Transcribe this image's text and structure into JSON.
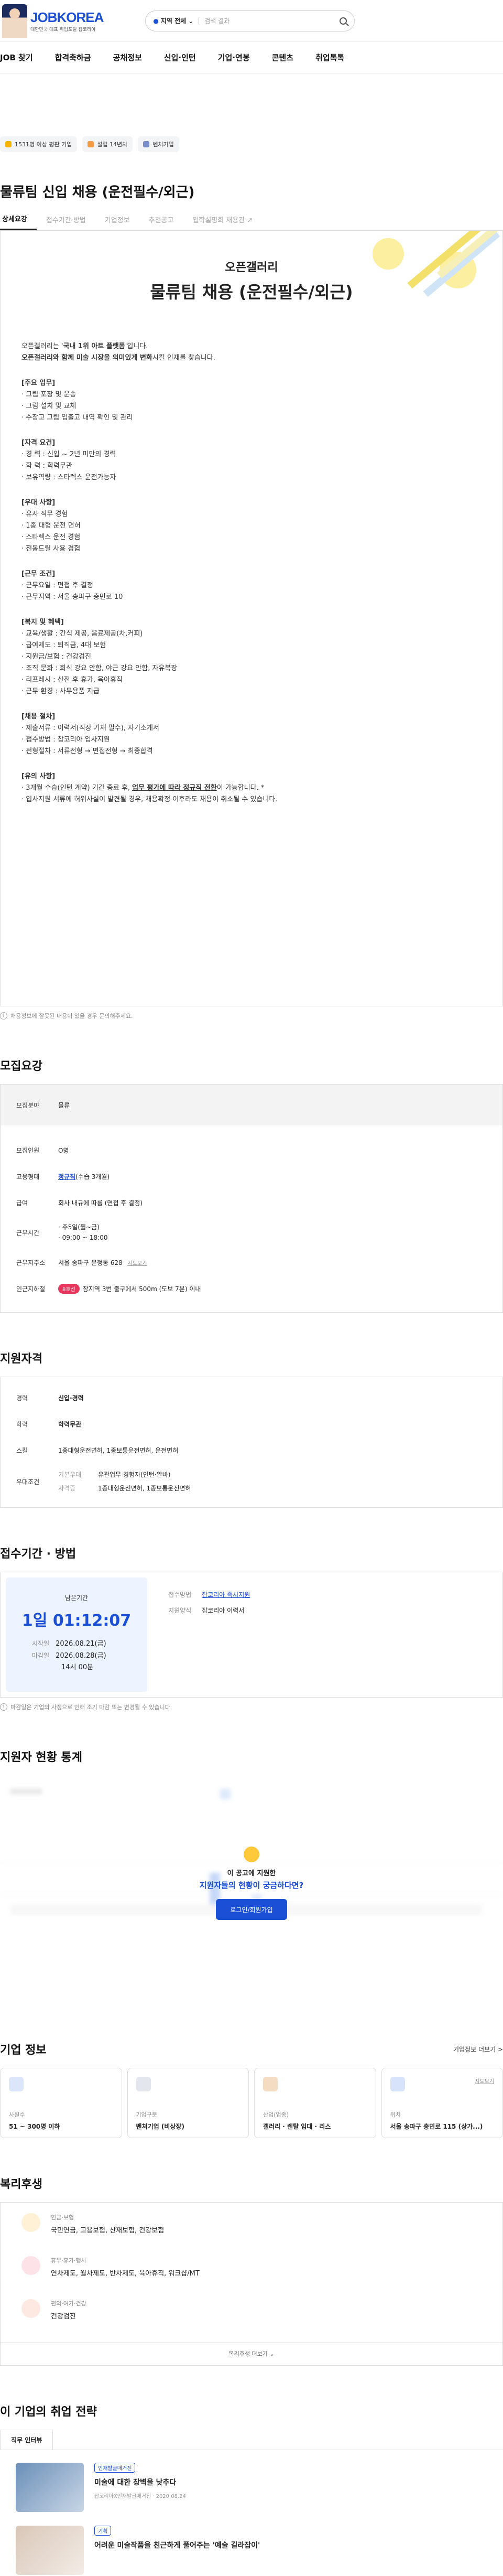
{
  "header": {
    "brand": "JOBKOREA",
    "tagline": "대한민국 대표 취업포털 잡코리아",
    "search_region": "지역 전체",
    "search_placeholder": "검색 결과"
  },
  "nav": [
    "JOB 찾기",
    "합격축하금",
    "공채정보",
    "신입·인턴",
    "기업·연봉",
    "콘텐츠",
    "취업톡톡"
  ],
  "badges": [
    {
      "label": "1531명 이상 평판 기업",
      "color": "#f7b500"
    },
    {
      "label": "설립 14년차",
      "color": "#f29b43"
    },
    {
      "label": "벤처기업",
      "color": "#7a8fc9"
    }
  ],
  "job": {
    "title": "물류팀 신입 채용 (운전필수/외근)",
    "tabs": [
      "상세요강",
      "접수기간·방법",
      "기업정보",
      "추천공고",
      "입학설명회 채용관"
    ]
  },
  "poster": {
    "company": "오픈갤러리",
    "title": "물류팀 채용 (운전필수/외근)",
    "intro1_a": "오픈갤러리는 '",
    "intro1_b": "국내 1위 아트 플랫폼",
    "intro1_c": "'입니다.",
    "intro2_a": "오픈갤러리와 함께 미술 시장을 의미있게 변화",
    "intro2_b": "시킬 인재를 찾습니다.",
    "sections": [
      {
        "h": "[주요 업무]",
        "lines": [
          "· 그림 포장 및 운송",
          "· 그림 설치 및 교체",
          "· 수장고 그림 입출고 내역 확인 및 관리"
        ]
      },
      {
        "h": "[자격 요건]",
        "lines": [
          "· 경      력 : 신입 ~ 2년 미만의 경력",
          "· 학      력 : 학력무관",
          "· 보유역량 : 스타렉스 운전가능자"
        ]
      },
      {
        "h": "[우대 사항]",
        "lines": [
          "· 유사 직무 경험",
          "· 1종 대형 운전 면허",
          "· 스타렉스 운전 경험",
          "· 전동드릴 사용 경험"
        ]
      },
      {
        "h": "[근무 조건]",
        "lines": [
          "· 근무요일 : 면접 후 결정",
          "· 근무지역 : 서울 송파구 충민로 10"
        ]
      },
      {
        "h": "[복지 및 혜택]",
        "lines": [
          "· 교육/생활 : 간식 제공, 음료제공(차,커피)",
          "· 급여제도 : 퇴직금, 4대 보험",
          "· 지원금/보험 : 건강검진",
          "· 조직 문화 : 회식 강요 안함, 야근 강요 안함, 자유복장",
          "· 리프레시 : 산전 후 휴가, 육아휴직",
          "· 근무 환경 : 사무용품 지급"
        ]
      },
      {
        "h": "[채용 절차]",
        "lines": [
          "· 제출서류 : 이력서(직장 기재 필수), 자기소개서",
          "· 접수방법 : 잡코리아 입사지원",
          "· 전형절차 : 서류전형 → 면접전형 → 최종합격"
        ]
      }
    ],
    "caution_h": "[유의 사항]",
    "caution1_a": "· 3개월 수습(인턴 계약) 기간 종료 후, ",
    "caution1_b": "업무 평가에 따라 정규직 전환",
    "caution1_c": "이 가능합니다. *",
    "caution2": "· 입사지원 서류에 허위사실이 발견될 경우, 채용확정 이후라도 채용이 취소될 수 있습니다."
  },
  "poster_note": "채용정보에 잘못된 내용이 있을 경우 문의해주세요.",
  "recruit": {
    "heading": "모집요강",
    "col1": "모집분야",
    "col2": "물류",
    "rows": [
      {
        "k": "모집인원",
        "v": "O명"
      },
      {
        "k": "고용형태",
        "v": "정규직",
        "v2": "(수습 3개월)"
      },
      {
        "k": "급여",
        "v": "회사 내규에 따름 (면접 후 결정)"
      },
      {
        "k": "근무시간",
        "v": "· 주5일(월~금)",
        "v2": "· 09:00 ~ 18:00"
      },
      {
        "k": "근무지주소",
        "v": "서울 송파구 문정동 628",
        "v2": "지도보기"
      },
      {
        "k": "인근지하철",
        "pill": "8호선",
        "v": "장지역 3번 출구에서 500m (도보 7분) 이내"
      }
    ]
  },
  "qual": {
    "heading": "지원자격",
    "rows": [
      {
        "k": "경력",
        "v": "신입·경력"
      },
      {
        "k": "학력",
        "v": "학력무관"
      },
      {
        "k": "스킬",
        "v": "1종대형운전면허, 1종보통운전면허, 운전면허"
      },
      {
        "k": "우대조건",
        "sub": [
          {
            "k": "기본우대",
            "v": "유관업무 경험자(인턴·알바)"
          },
          {
            "k": "자격증",
            "v": "1종대형운전면허, 1종보통운전면허"
          }
        ]
      }
    ]
  },
  "apply": {
    "heading": "접수기간 · 방법",
    "remaining_label": "남은기간",
    "remaining": "1일 01:12:07",
    "start_label": "시작일",
    "start": "2026.08.21(금)",
    "end_label": "마감일",
    "end": "2026.08.28(금)",
    "end_time": "14시 00분",
    "method_label": "접수방법",
    "method": "잡코리아 즉시지원",
    "form_label": "지원양식",
    "form": "잡코리아 이력서",
    "note": "마감일은 기업의 사정으로 인해 조기 마감 또는 변경될 수 있습니다."
  },
  "stats": {
    "heading": "지원자 현황 통계",
    "q1": "이 공고에 지원한",
    "q2": "지원자들의 현황이 궁금하다면?",
    "btn": "로그인/회원가입"
  },
  "company": {
    "heading": "기업 정보",
    "more": "기업정보 더보기 >",
    "cards": [
      {
        "k": "사원수",
        "v": "51 ~ 300명 이하",
        "color": "#5b8def"
      },
      {
        "k": "기업구분",
        "v": "벤처기업 (비상장)",
        "color": "#8a94a6"
      },
      {
        "k": "산업(업종)",
        "v": "갤러리 · 렌탈 임대 · 리스",
        "color": "#c77a2a"
      },
      {
        "k": "위치",
        "v": "서울 송파구 충민로 115 (상가...)",
        "color": "#2f6fe0",
        "link": "지도보기"
      }
    ]
  },
  "welfare": {
    "heading": "복리후생",
    "rows": [
      {
        "k": "연금·보험",
        "v": "국민연금, 고용보험, 산재보험, 건강보험",
        "color": "#f0a020"
      },
      {
        "k": "휴무·휴가·행사",
        "v": "연차제도, 월차제도, 반차제도, 육아휴직, 워크샵/MT",
        "color": "#e8365d"
      },
      {
        "k": "편의·여가·건강",
        "v": "건강검진",
        "color": "#f7b7a0"
      }
    ],
    "more": "복리후생 더보기"
  },
  "strategy": {
    "heading": "이 기업의 취업 전략",
    "tab": "직무 인터뷰",
    "items": [
      {
        "tag": "인재발굴매거진",
        "title": "미술에 대한 장벽을 낮추다",
        "meta": "잡코리아X인재발굴매거진 · 2020.08.24",
        "color": "#6a8fb8"
      },
      {
        "tag": "기획",
        "title": "어려운 미술작품을 친근하게 풀어주는 '예술 길라잡이'",
        "meta": "",
        "color": "#d9c7b8"
      }
    ]
  }
}
